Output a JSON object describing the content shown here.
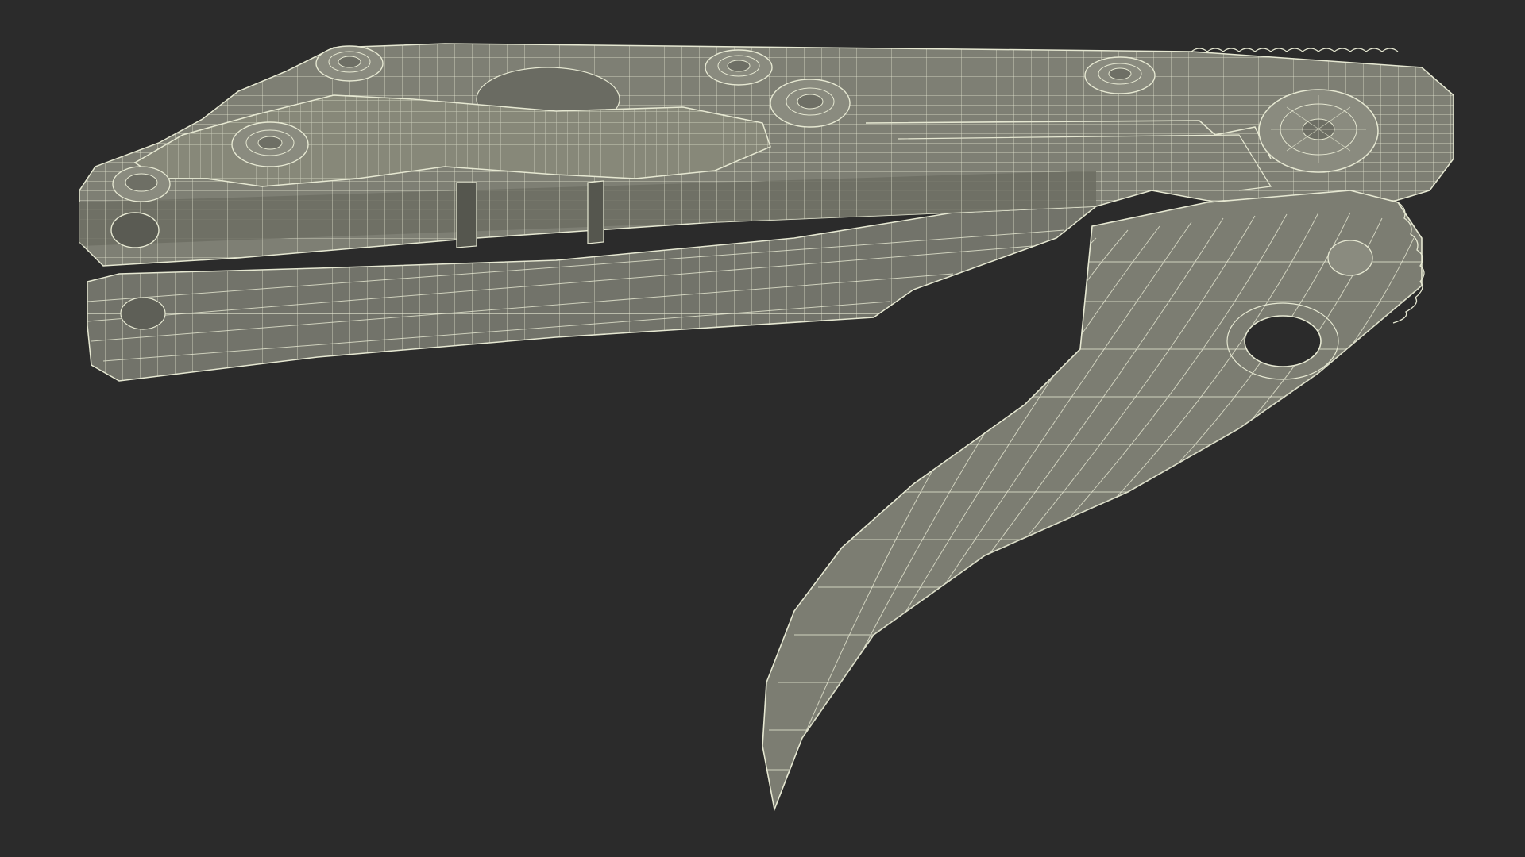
{
  "scene": {
    "subject": "wireframe-folding-knife",
    "render_style": "wireframe-over-shaded",
    "colors": {
      "background": "#2b2b2b",
      "surface": "#7e7f74",
      "surface_dark": "#6c6d63",
      "surface_light": "#8d8e83",
      "wire": "#e6e8d2",
      "shadow": "#1f1f1f"
    }
  }
}
